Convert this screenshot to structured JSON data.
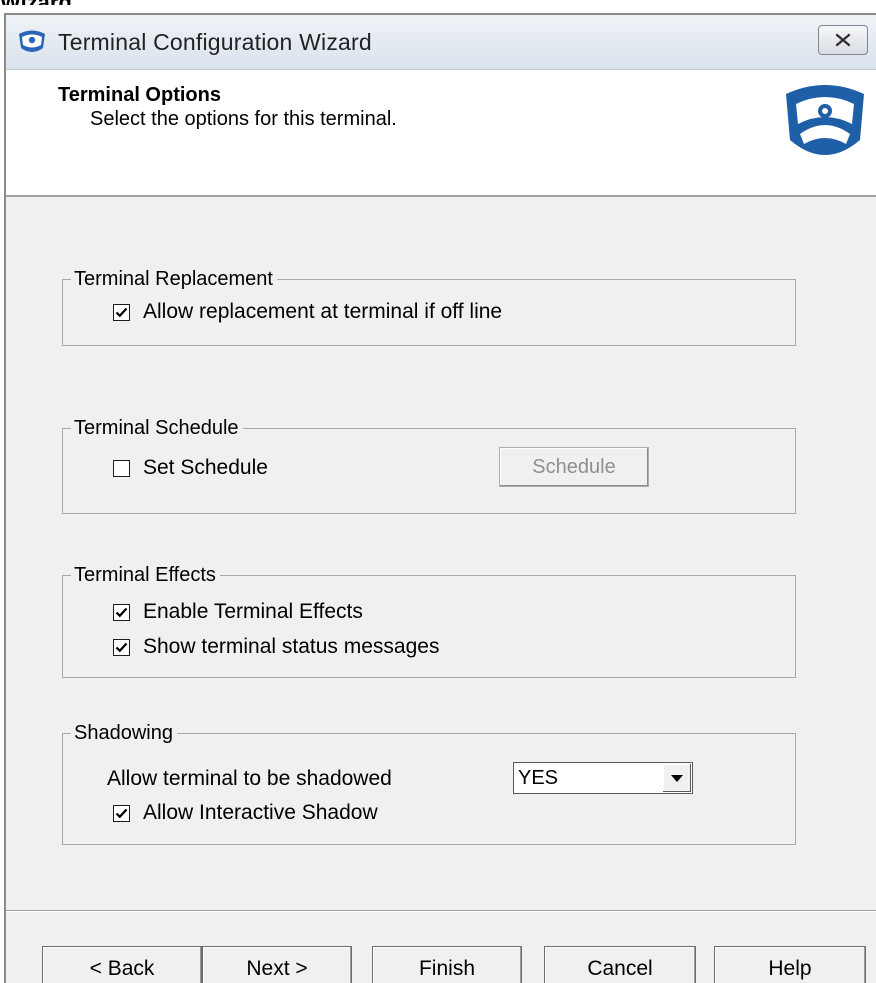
{
  "caption": "Wizard",
  "window": {
    "title": "Terminal Configuration Wizard"
  },
  "header": {
    "title": "Terminal Options",
    "subtitle": "Select the options for this terminal."
  },
  "groups": {
    "replacement": {
      "label": "Terminal Replacement",
      "allow_replacement": {
        "label": "Allow replacement at terminal if off line",
        "checked": true
      }
    },
    "schedule": {
      "label": "Terminal Schedule",
      "set_schedule": {
        "label": "Set Schedule",
        "checked": false
      },
      "schedule_button": "Schedule"
    },
    "effects": {
      "label": "Terminal Effects",
      "enable_effects": {
        "label": "Enable Terminal Effects",
        "checked": true
      },
      "show_status": {
        "label": "Show terminal status messages",
        "checked": true
      }
    },
    "shadowing": {
      "label": "Shadowing",
      "allow_shadow_label": "Allow terminal to be shadowed",
      "allow_shadow_value": "YES",
      "interactive_shadow": {
        "label": "Allow Interactive Shadow",
        "checked": true
      }
    }
  },
  "buttons": {
    "back": "< Back",
    "next": "Next >",
    "finish": "Finish",
    "cancel": "Cancel",
    "help": "Help"
  },
  "icons": {
    "app": "thinmanager-mask-icon",
    "logo": "thinmanager-logo-icon",
    "close": "close-icon",
    "checkbox": "checkmark-icon",
    "dropdown": "chevron-down-icon"
  },
  "colors": {
    "dialog_bg": "#f0f0f0",
    "header_bg": "#ffffff",
    "logo_blue": "#1f5fa8"
  }
}
